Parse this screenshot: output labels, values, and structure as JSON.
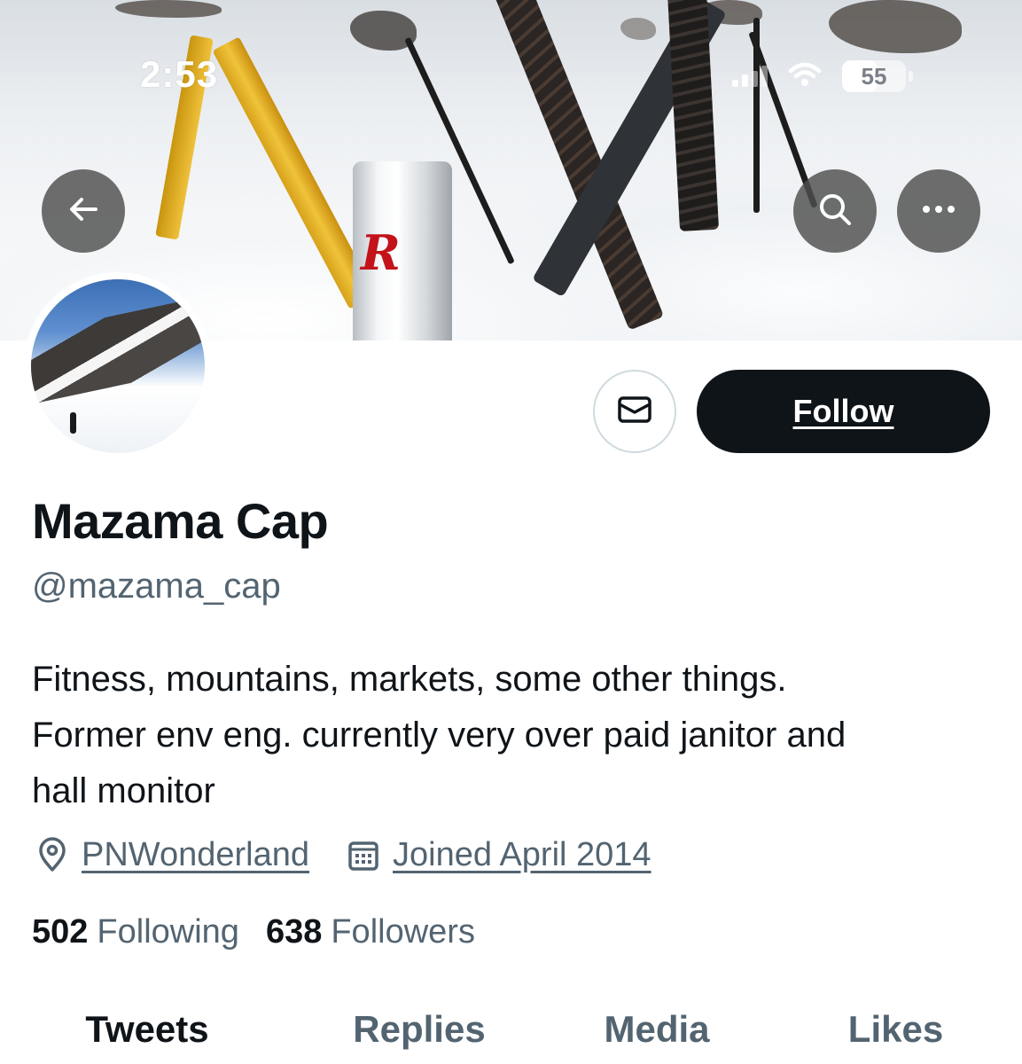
{
  "status_bar": {
    "time": "2:53",
    "battery": "55",
    "battery_level": 0.55
  },
  "header": {
    "back_icon": "arrow-left-icon",
    "search_icon": "search-icon",
    "more_icon": "more-horizontal-icon"
  },
  "profile": {
    "display_name": "Mazama Cap",
    "handle": "@mazama_cap",
    "bio_lines": [
      "Fitness, mountains, markets, some other things.",
      "Former env eng. currently very over paid janitor and",
      "hall monitor"
    ],
    "location": "PNWonderland",
    "joined": "Joined April 2014",
    "following_count": "502",
    "following_label": "Following",
    "followers_count": "638",
    "followers_label": "Followers"
  },
  "actions": {
    "message_icon": "envelope-icon",
    "follow_label": "Follow"
  },
  "tabs": [
    {
      "label": "Tweets",
      "active": true
    },
    {
      "label": "Replies",
      "active": false
    },
    {
      "label": "Media",
      "active": false
    },
    {
      "label": "Likes",
      "active": false
    }
  ],
  "colors": {
    "text_primary": "#0f1419",
    "text_secondary": "#536471",
    "button_dark": "#0f1419",
    "border": "#cfd9de"
  }
}
